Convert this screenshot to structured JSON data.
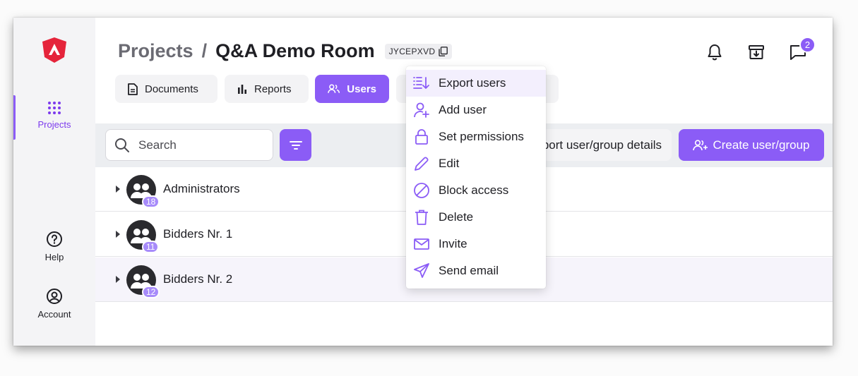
{
  "sidebar": {
    "logo": "app-logo",
    "items": [
      {
        "label": "Projects",
        "icon": "grid-dots-icon",
        "active": true
      },
      {
        "label": "Help",
        "icon": "help-circle-icon"
      },
      {
        "label": "Account",
        "icon": "account-circle-icon"
      }
    ]
  },
  "header": {
    "breadcrumb_parent": "Projects",
    "breadcrumb_separator": "/",
    "breadcrumb_current": "Q&A Demo Room",
    "room_code": "JYCEPXVD",
    "notification_count": "2",
    "icons": [
      "bell-icon",
      "archive-download-icon",
      "chat-icon"
    ]
  },
  "tabs": [
    {
      "label": "Documents",
      "icon": "document-icon"
    },
    {
      "label": "Reports",
      "icon": "bar-chart-icon"
    },
    {
      "label": "Users",
      "icon": "users-icon",
      "active": true
    }
  ],
  "toolbar": {
    "search_placeholder": "Search",
    "export_details_label": "Export user/group details",
    "create_label": "Create user/group"
  },
  "groups": [
    {
      "name": "Administrators",
      "count": "18"
    },
    {
      "name": "Bidders Nr. 1",
      "count": "11"
    },
    {
      "name": "Bidders Nr. 2",
      "count": "12"
    }
  ],
  "menu": {
    "items": [
      {
        "label": "Export users",
        "icon": "export-list-icon"
      },
      {
        "label": "Add user",
        "icon": "add-user-icon"
      },
      {
        "label": "Set permissions",
        "icon": "lock-icon"
      },
      {
        "label": "Edit",
        "icon": "pencil-icon"
      },
      {
        "label": "Block access",
        "icon": "block-icon"
      },
      {
        "label": "Delete",
        "icon": "trash-icon"
      },
      {
        "label": "Invite",
        "icon": "mail-icon"
      },
      {
        "label": "Send email",
        "icon": "send-icon"
      }
    ]
  },
  "colors": {
    "accent": "#8b5cf6",
    "accent_light": "#a78bfa",
    "logo_red": "#e5243b"
  }
}
